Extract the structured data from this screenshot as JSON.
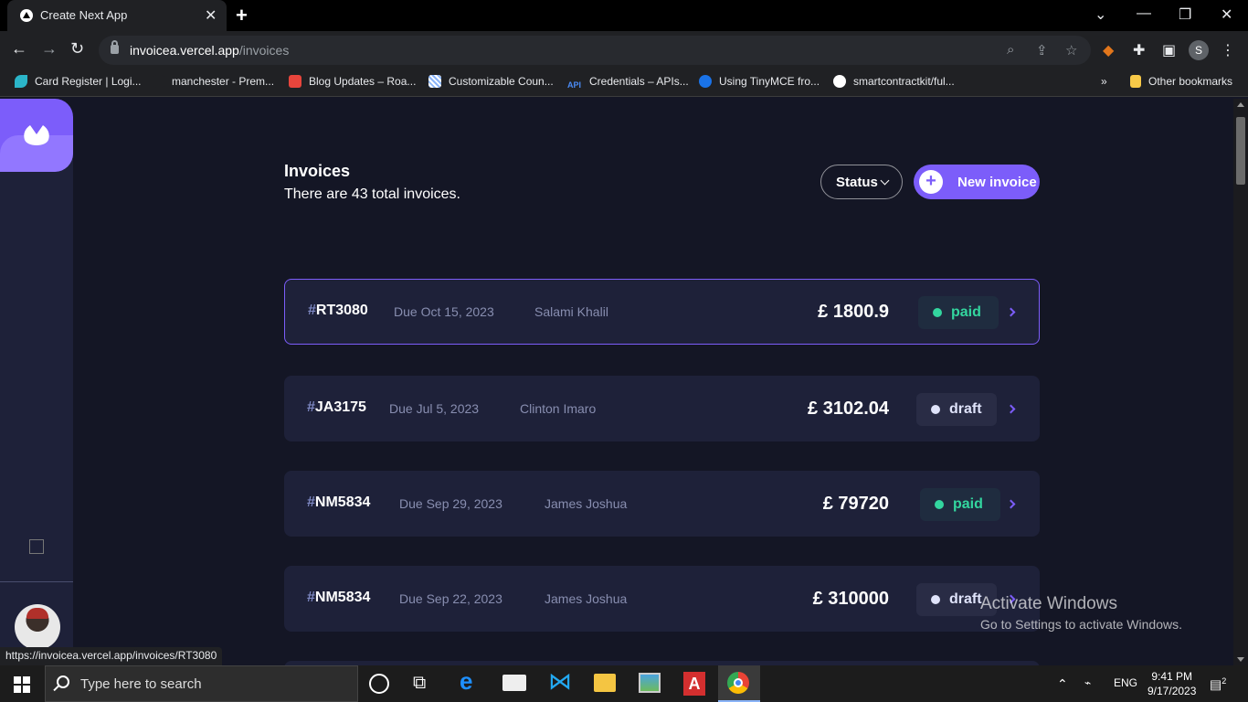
{
  "browser": {
    "tab_title": "Create Next App",
    "url_host": "invoicea.vercel.app",
    "url_path": "/invoices",
    "profile_initial": "S",
    "status_url": "https://invoicea.vercel.app/invoices/RT3080",
    "bookmarks": [
      {
        "label": "Card Register | Logi...",
        "icon": "leaf-icon",
        "color": "#2bb5c9"
      },
      {
        "label": "manchester - Prem...",
        "icon": "lion-icon",
        "color": "#3d195b"
      },
      {
        "label": "Blog Updates – Roa...",
        "icon": "shield-icon",
        "color": "#e8453c"
      },
      {
        "label": "Customizable Coun...",
        "icon": "pattern-icon",
        "color": "#8ab4f8"
      },
      {
        "label": "Credentials – APIs...",
        "icon": "api-icon",
        "color": "#4a8af4"
      },
      {
        "label": "Using TinyMCE fro...",
        "icon": "tinymce-icon",
        "color": "#1a73e8"
      },
      {
        "label": "smartcontractkit/ful...",
        "icon": "github-icon",
        "color": "#ffffff"
      }
    ],
    "other_bookmarks": "Other bookmarks"
  },
  "app": {
    "title": "Invoices",
    "subtitle": "There are 43 total invoices.",
    "status_filter": "Status",
    "new_invoice": "New invoice",
    "accent": "#7c5dfa",
    "invoices": [
      {
        "hash": "#",
        "id": "RT3080",
        "due": "Due Oct 15, 2023",
        "name": "Salami Khalil",
        "amount": "£ 1800.9",
        "status": "paid"
      },
      {
        "hash": "#",
        "id": "JA3175",
        "due": "Due Jul 5, 2023",
        "name": "Clinton Imaro",
        "amount": "£ 3102.04",
        "status": "draft"
      },
      {
        "hash": "#",
        "id": "NM5834",
        "due": "Due Sep 29, 2023",
        "name": "James Joshua",
        "amount": "£ 79720",
        "status": "paid"
      },
      {
        "hash": "#",
        "id": "NM5834",
        "due": "Due Sep 22, 2023",
        "name": "James Joshua",
        "amount": "£ 310000",
        "status": "draft"
      }
    ]
  },
  "watermark": {
    "line1": "Activate Windows",
    "line2": "Go to Settings to activate Windows."
  },
  "taskbar": {
    "search_placeholder": "Type here to search",
    "language": "ENG",
    "time": "9:41 PM",
    "date": "9/17/2023",
    "notifications": "2"
  }
}
